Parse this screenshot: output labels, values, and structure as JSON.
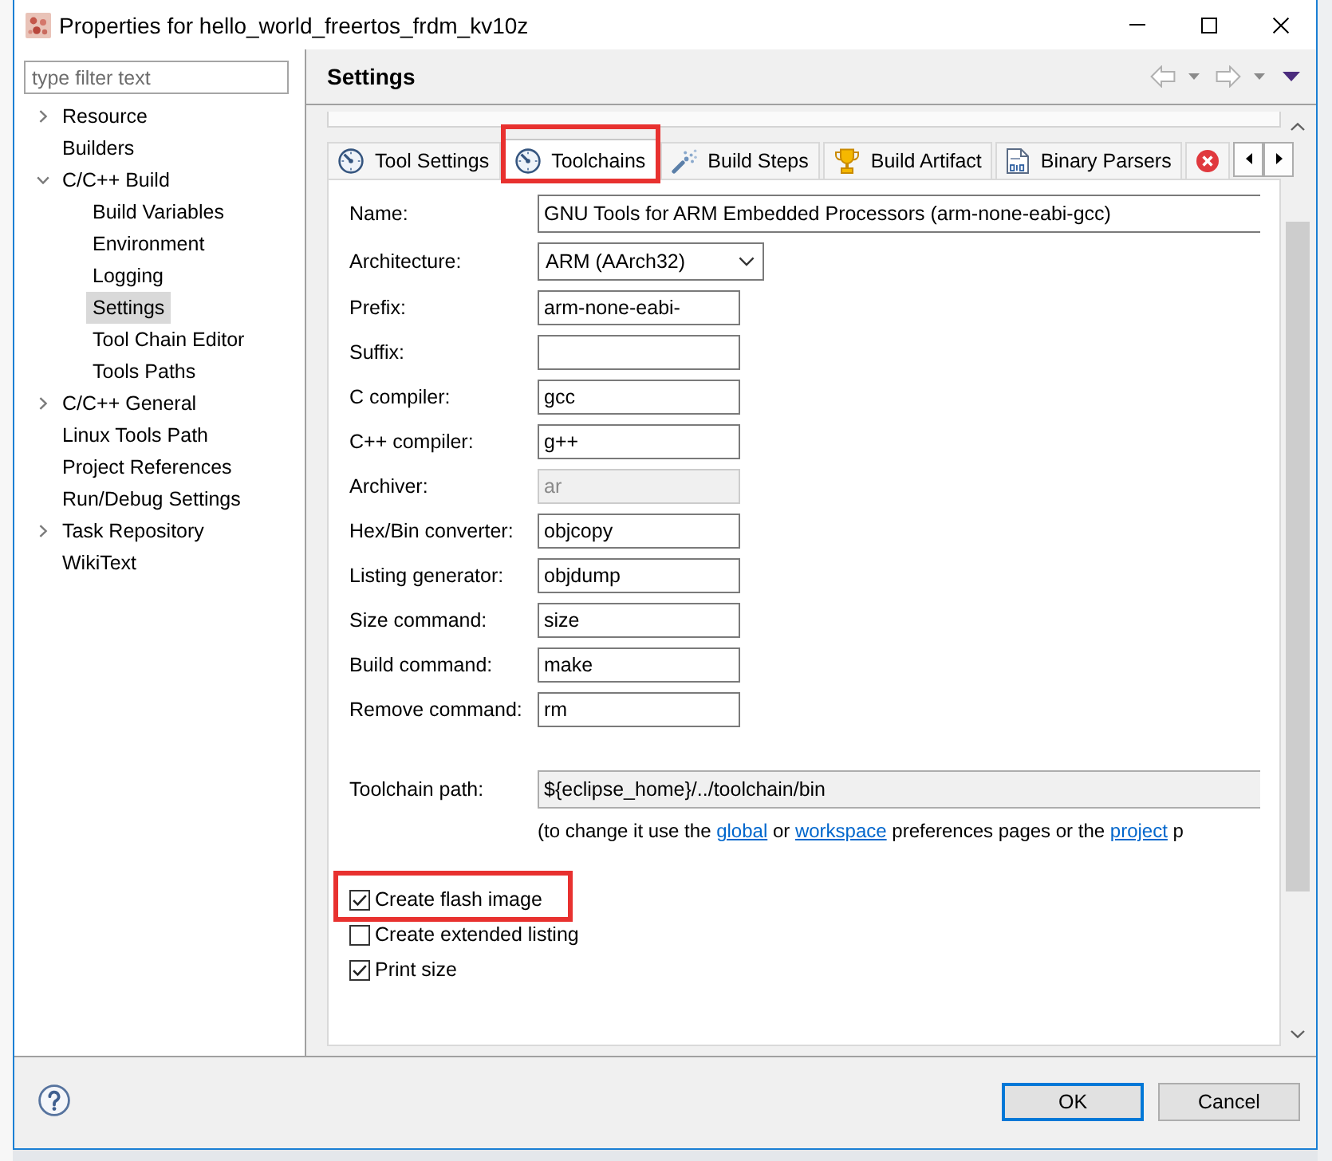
{
  "window": {
    "title": "Properties for hello_world_freertos_frdm_kv10z"
  },
  "sidebar": {
    "filter": {
      "placeholder": "type filter text"
    },
    "tree": [
      {
        "label": "Resource",
        "expanded": false,
        "selected": false
      },
      {
        "label": "Builders",
        "selected": false
      },
      {
        "label": "C/C++ Build",
        "expanded": true,
        "selected": false,
        "children": [
          {
            "label": "Build Variables",
            "selected": false
          },
          {
            "label": "Environment",
            "selected": false
          },
          {
            "label": "Logging",
            "selected": false
          },
          {
            "label": "Settings",
            "selected": true
          },
          {
            "label": "Tool Chain Editor",
            "selected": false
          },
          {
            "label": "Tools Paths",
            "selected": false
          }
        ]
      },
      {
        "label": "C/C++ General",
        "expanded": false,
        "selected": false
      },
      {
        "label": "Linux Tools Path",
        "selected": false
      },
      {
        "label": "Project References",
        "selected": false
      },
      {
        "label": "Run/Debug Settings",
        "selected": false
      },
      {
        "label": "Task Repository",
        "expanded": false,
        "selected": false
      },
      {
        "label": "WikiText",
        "selected": false
      }
    ]
  },
  "page": {
    "title": "Settings",
    "tabs": [
      {
        "label": "Tool Settings",
        "selected": false,
        "highlighted": false
      },
      {
        "label": "Toolchains",
        "selected": true,
        "highlighted": true
      },
      {
        "label": "Build Steps",
        "selected": false,
        "highlighted": false
      },
      {
        "label": "Build Artifact",
        "selected": false,
        "highlighted": false
      },
      {
        "label": "Binary Parsers",
        "selected": false,
        "highlighted": false
      },
      {
        "selected": false,
        "highlighted": false
      }
    ],
    "fields": [
      {
        "label": "Name:",
        "kind": "wide",
        "value": "GNU Tools for ARM Embedded Processors (arm-none-eabi-gcc)",
        "disabled": false
      },
      {
        "label": "Architecture:",
        "kind": "dropdown",
        "value": "ARM (AArch32)",
        "disabled": false
      },
      {
        "label": "Prefix:",
        "kind": "text",
        "value": "arm-none-eabi-",
        "disabled": false
      },
      {
        "label": "Suffix:",
        "kind": "text",
        "disabled": false
      },
      {
        "label": "C compiler:",
        "kind": "text",
        "value": "gcc",
        "disabled": false
      },
      {
        "label": "C++ compiler:",
        "kind": "text",
        "value": "g++",
        "disabled": false
      },
      {
        "label": "Archiver:",
        "kind": "text",
        "value": "ar",
        "disabled": true
      },
      {
        "label": "Hex/Bin converter:",
        "kind": "text",
        "value": "objcopy",
        "disabled": false
      },
      {
        "label": "Listing generator:",
        "kind": "text",
        "value": "objdump",
        "disabled": false
      },
      {
        "label": "Size command:",
        "kind": "text",
        "value": "size",
        "disabled": false
      },
      {
        "label": "Build command:",
        "kind": "text",
        "value": "make",
        "disabled": false
      },
      {
        "label": "Remove command:",
        "kind": "text",
        "value": "rm",
        "disabled": false
      }
    ],
    "toolchain_path": {
      "label": "Toolchain path:",
      "value": "${eclipse_home}/../toolchain/bin",
      "readonly": true
    },
    "note": [
      {
        "text": "(to change it use the ",
        "link": false
      },
      {
        "text": "global",
        "link": true
      },
      {
        "text": " or ",
        "link": false
      },
      {
        "text": "workspace",
        "link": true
      },
      {
        "text": " preferences pages or the ",
        "link": false
      },
      {
        "text": "project",
        "link": true
      },
      {
        "text": " p",
        "link": false
      }
    ],
    "options": [
      {
        "label": "Create flash image",
        "checked": true,
        "highlighted": true
      },
      {
        "label": "Create extended listing",
        "checked": false,
        "highlighted": false
      },
      {
        "label": "Print size",
        "checked": true,
        "highlighted": false
      }
    ]
  },
  "buttons": [
    {
      "label": "OK",
      "default": true
    },
    {
      "label": "Cancel",
      "default": false
    }
  ]
}
